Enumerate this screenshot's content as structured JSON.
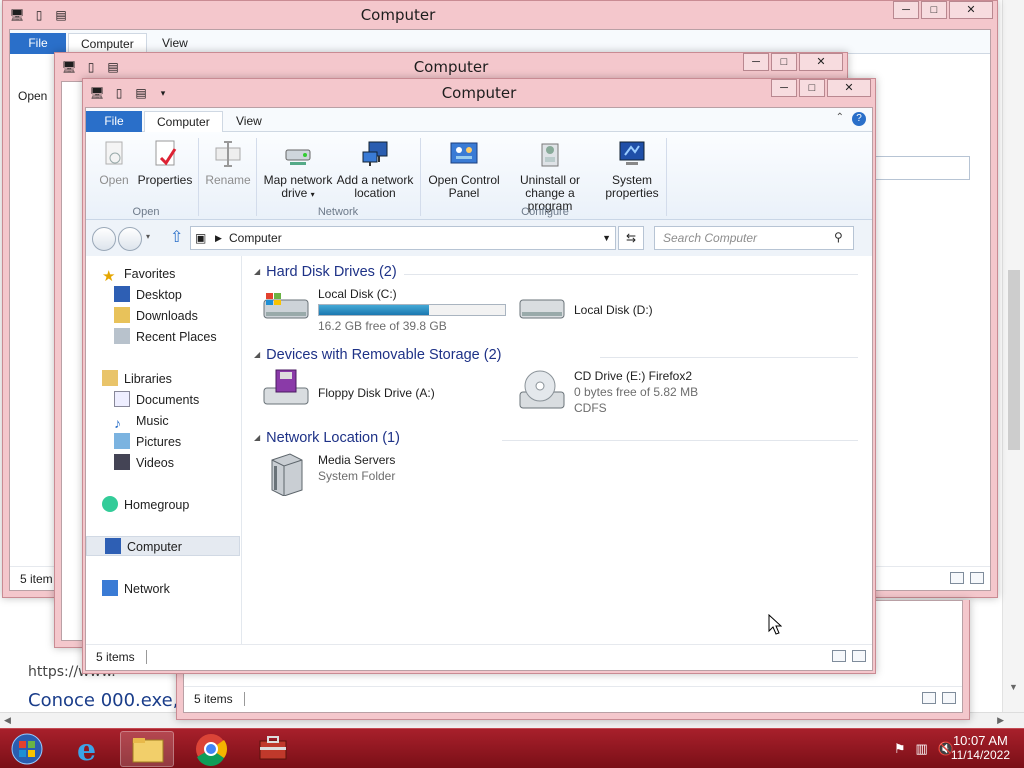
{
  "background": {
    "url_text": "https://www.",
    "link_text": "Conoce 000.exe,"
  },
  "window": {
    "title": "Computer",
    "tabs": {
      "file": "File",
      "computer": "Computer",
      "view": "View"
    },
    "ribbon": {
      "open": "Open",
      "properties": "Properties",
      "rename": "Rename",
      "map_drive": "Map network drive",
      "add_location": "Add a network location",
      "control_panel": "Open Control Panel",
      "uninstall": "Uninstall or change a program",
      "system_properties": "System properties",
      "group_open": "Open",
      "group_network": "Network",
      "group_configure": "Configure"
    },
    "address": {
      "path": "Computer",
      "search_placeholder": "Search Computer"
    },
    "nav": {
      "favorites": "Favorites",
      "desktop": "Desktop",
      "downloads": "Downloads",
      "recent": "Recent Places",
      "libraries": "Libraries",
      "documents": "Documents",
      "music": "Music",
      "pictures": "Pictures",
      "videos": "Videos",
      "homegroup": "Homegroup",
      "computer": "Computer",
      "network": "Network"
    },
    "groups": {
      "hdd": "Hard Disk Drives (2)",
      "removable": "Devices with Removable Storage (2)",
      "network": "Network Location (1)"
    },
    "items": {
      "c_name": "Local Disk (C:)",
      "c_free": "16.2 GB free of 39.8 GB",
      "c_used_fraction": 0.59,
      "d_name": "Local Disk (D:)",
      "floppy": "Floppy Disk Drive (A:)",
      "cd_name": "CD Drive (E:) Firefox2",
      "cd_free": "0 bytes free of 5.82 MB",
      "cd_fs": "CDFS",
      "media_name": "Media Servers",
      "media_type": "System Folder"
    },
    "status": "5 items"
  },
  "back_windows": {
    "title1": "Computer",
    "title2": "Computer",
    "status": "5 items",
    "file": "File",
    "computer": "Computer",
    "view": "View",
    "open": "Open",
    "status_b": "5 item",
    "status_c": "5 items"
  },
  "taskbar": {
    "time": "10:07 AM",
    "date": "11/14/2022"
  },
  "colors": {
    "window_frame": "#f4c7cc",
    "taskbar": "#8e1620",
    "group_header": "#1e3287",
    "file_tab": "#2a6fc9"
  }
}
